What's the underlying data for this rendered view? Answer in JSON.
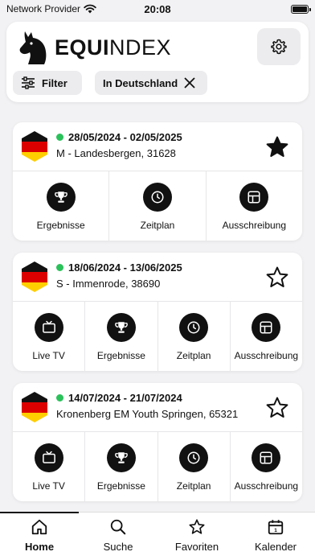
{
  "status_bar": {
    "carrier": "Network Provider",
    "time": "20:08"
  },
  "header": {
    "logo_bold": "EQUI",
    "logo_thin": "NDEX",
    "filter_label": "Filter",
    "location_chip": "In Deutschland"
  },
  "events": [
    {
      "dates": "28/05/2024 - 02/05/2025",
      "location": "M - Landesbergen, 31628",
      "favorite": true,
      "actions": [
        {
          "label": "Ergebnisse",
          "icon": "trophy-icon"
        },
        {
          "label": "Zeitplan",
          "icon": "clock-icon"
        },
        {
          "label": "Ausschreibung",
          "icon": "grid-icon"
        }
      ]
    },
    {
      "dates": "18/06/2024 - 13/06/2025",
      "location": "S - Immenrode, 38690",
      "favorite": false,
      "actions": [
        {
          "label": "Live TV",
          "icon": "tv-icon"
        },
        {
          "label": "Ergebnisse",
          "icon": "trophy-icon"
        },
        {
          "label": "Zeitplan",
          "icon": "clock-icon"
        },
        {
          "label": "Ausschreibung",
          "icon": "grid-icon"
        }
      ]
    },
    {
      "dates": "14/07/2024 - 21/07/2024",
      "location": "Kronenberg EM Youth Springen, 65321",
      "favorite": false,
      "actions": [
        {
          "label": "Live TV",
          "icon": "tv-icon"
        },
        {
          "label": "Ergebnisse",
          "icon": "trophy-icon"
        },
        {
          "label": "Zeitplan",
          "icon": "clock-icon"
        },
        {
          "label": "Ausschreibung",
          "icon": "grid-icon"
        }
      ]
    }
  ],
  "nav": {
    "items": [
      {
        "label": "Home",
        "icon": "home-icon",
        "active": true
      },
      {
        "label": "Suche",
        "icon": "search-icon",
        "active": false
      },
      {
        "label": "Favoriten",
        "icon": "star-icon",
        "active": false
      },
      {
        "label": "Kalender",
        "icon": "calendar-icon",
        "active": false
      }
    ]
  },
  "colors": {
    "active_dot": "#2bc15a",
    "flag_black": "#111111",
    "flag_red": "#dd0000",
    "flag_gold": "#ffce00"
  }
}
